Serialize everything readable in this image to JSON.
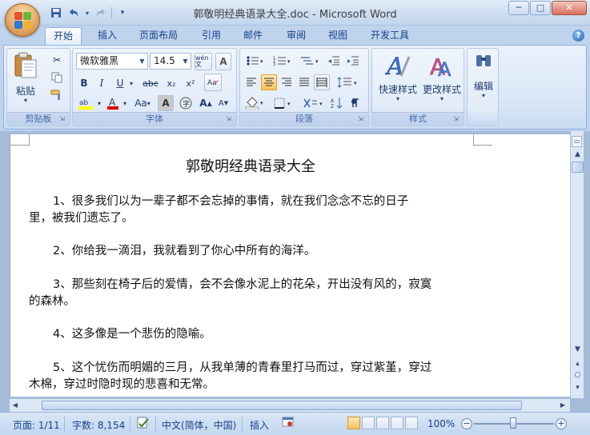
{
  "window": {
    "title": "郭敬明经典语录大全.doc - Microsoft Word",
    "controls": {
      "minimize": "─",
      "maximize": "□",
      "close": "✕"
    }
  },
  "quick_access": {
    "save_icon": "save-icon",
    "undo_icon": "undo-icon",
    "redo_icon": "redo-icon",
    "customize_icon": "chevron-down-icon"
  },
  "tabs": [
    "开始",
    "插入",
    "页面布局",
    "引用",
    "邮件",
    "审阅",
    "视图",
    "开发工具"
  ],
  "active_tab": "开始",
  "ribbon": {
    "clipboard": {
      "label": "剪贴板",
      "paste": "粘贴"
    },
    "font": {
      "label": "字体",
      "font_name": "微软雅黑",
      "font_size": "14.5",
      "bold": "B",
      "italic": "I",
      "underline": "U",
      "strike": "abc",
      "subscript": "x₂",
      "superscript": "x²",
      "grow": "A",
      "shrink": "A",
      "change_case": "Aa",
      "wen": "wén 文"
    },
    "paragraph": {
      "label": "段落"
    },
    "styles": {
      "label": "样式",
      "quick_styles": "快速样式",
      "change_styles": "更改样式"
    },
    "editing": {
      "label": "编辑"
    }
  },
  "document": {
    "title": "郭敬明经典语录大全",
    "paragraphs": [
      [
        "1、很多我们以为一辈子都不会忘掉的事情，就在我们念念不忘的日子",
        "里，被我们遗忘了。"
      ],
      [
        "2、你给我一滴泪，我就看到了你心中所有的海洋。"
      ],
      [
        "3、那些刻在椅子后的爱情，会不会像水泥上的花朵，开出没有风的，寂寞",
        "的森林。"
      ],
      [
        "4、这多像是一个悲伤的隐喻。"
      ],
      [
        "5、这个忧伤而明媚的三月，从我单薄的青春里打马而过，穿过紫堇，穿过",
        "木棉，穿过时隐时现的悲喜和无常。"
      ]
    ]
  },
  "status_bar": {
    "page": "页面: 1/11",
    "words": "字数: 8,154",
    "language": "中文(简体，中国)",
    "mode": "插入",
    "zoom": "100%",
    "zoom_level": 100
  },
  "colors": {
    "ribbon_blue": "#bfd3ec",
    "highlight": "#ffff00",
    "font_color": "#e00000"
  }
}
